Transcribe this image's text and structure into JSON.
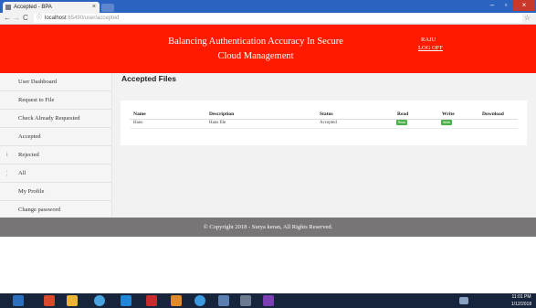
{
  "browser": {
    "tab_title": "Accepted - BPA",
    "tab_close": "×",
    "url_host": "localhost",
    "url_path": ":65490/user/accepted",
    "win_min": "–",
    "win_max": "▫",
    "win_close": "×",
    "star": "☆"
  },
  "header": {
    "site_title": "Balancing Authentication Accuracy In Secure Cloud Management",
    "user_name": "RAJU",
    "logoff_label": "LOG OFF"
  },
  "sidebar": {
    "items": [
      {
        "label": "User Dashboard"
      },
      {
        "label": "Request to File"
      },
      {
        "label": "Check Already Requested"
      },
      {
        "label": "Accepted"
      },
      {
        "label": "Rejected"
      },
      {
        "label": "All"
      },
      {
        "label": "My Profile"
      },
      {
        "label": "Change password"
      }
    ]
  },
  "main": {
    "heading": "Accepted Files",
    "table": {
      "columns": [
        "Name",
        "Description",
        "Status",
        "Read",
        "Write",
        "Download"
      ],
      "rows": [
        {
          "name": "Hans",
          "description": "Hans file",
          "status": "Accepted",
          "read": "Read",
          "write": "Write"
        }
      ]
    }
  },
  "footer": {
    "text": "© Copyright 2018 - Surya keran, All Rights Reserved."
  },
  "taskbar": {
    "time": "11:01 PM",
    "date": "1/12/2018"
  },
  "colors": {
    "header_bg": "#ff1a00",
    "footer_bg": "#777575",
    "badge_green": "#49b149"
  }
}
